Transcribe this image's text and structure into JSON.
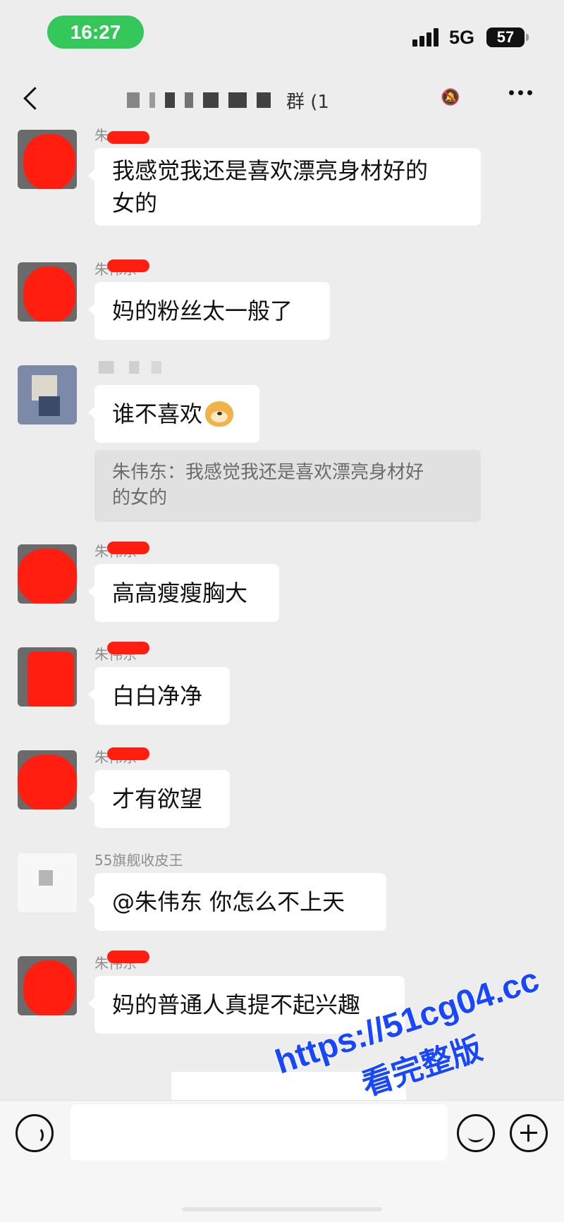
{
  "status_bar": {
    "time": "16:27",
    "network": "5G",
    "battery": "57"
  },
  "nav": {
    "title_visible": "群 (1",
    "back_icon": "chevron-left-icon",
    "more_icon": "more-dots-icon",
    "mute_icon": "bell-slash-icon"
  },
  "messages": [
    {
      "sender": "朱",
      "text_line1": "我感觉我还是喜欢漂亮身材好的",
      "text_line2": "女的"
    },
    {
      "sender": "朱伟东",
      "text": "妈的粉丝太一般了"
    },
    {
      "sender": "",
      "text": "谁不喜欢",
      "emoji": "doge-emoji",
      "quote_line1": "朱伟东：我感觉我还是喜欢漂亮身材好",
      "quote_line2": "的女的"
    },
    {
      "sender": "朱伟东",
      "text": "高高瘦瘦胸大"
    },
    {
      "sender": "朱伟东",
      "text": "白白净净"
    },
    {
      "sender": "朱伟东",
      "text": "才有欲望"
    },
    {
      "sender": "55旗舰收皮王",
      "text": "@朱伟东 你怎么不上天"
    },
    {
      "sender": "朱伟东",
      "text": "妈的普通人真提不起兴趣"
    }
  ],
  "input_bar": {
    "voice_icon": "voice-icon",
    "emoji_icon": "emoji-icon",
    "plus_icon": "plus-icon"
  },
  "watermark": {
    "url": "https://51cg04.cc",
    "caption": "看完整版"
  },
  "colors": {
    "bubble": "#ffffff",
    "background": "#ededed",
    "time_pill": "#34c759",
    "redaction": "#ff1e0f",
    "watermark": "#1947ff"
  }
}
